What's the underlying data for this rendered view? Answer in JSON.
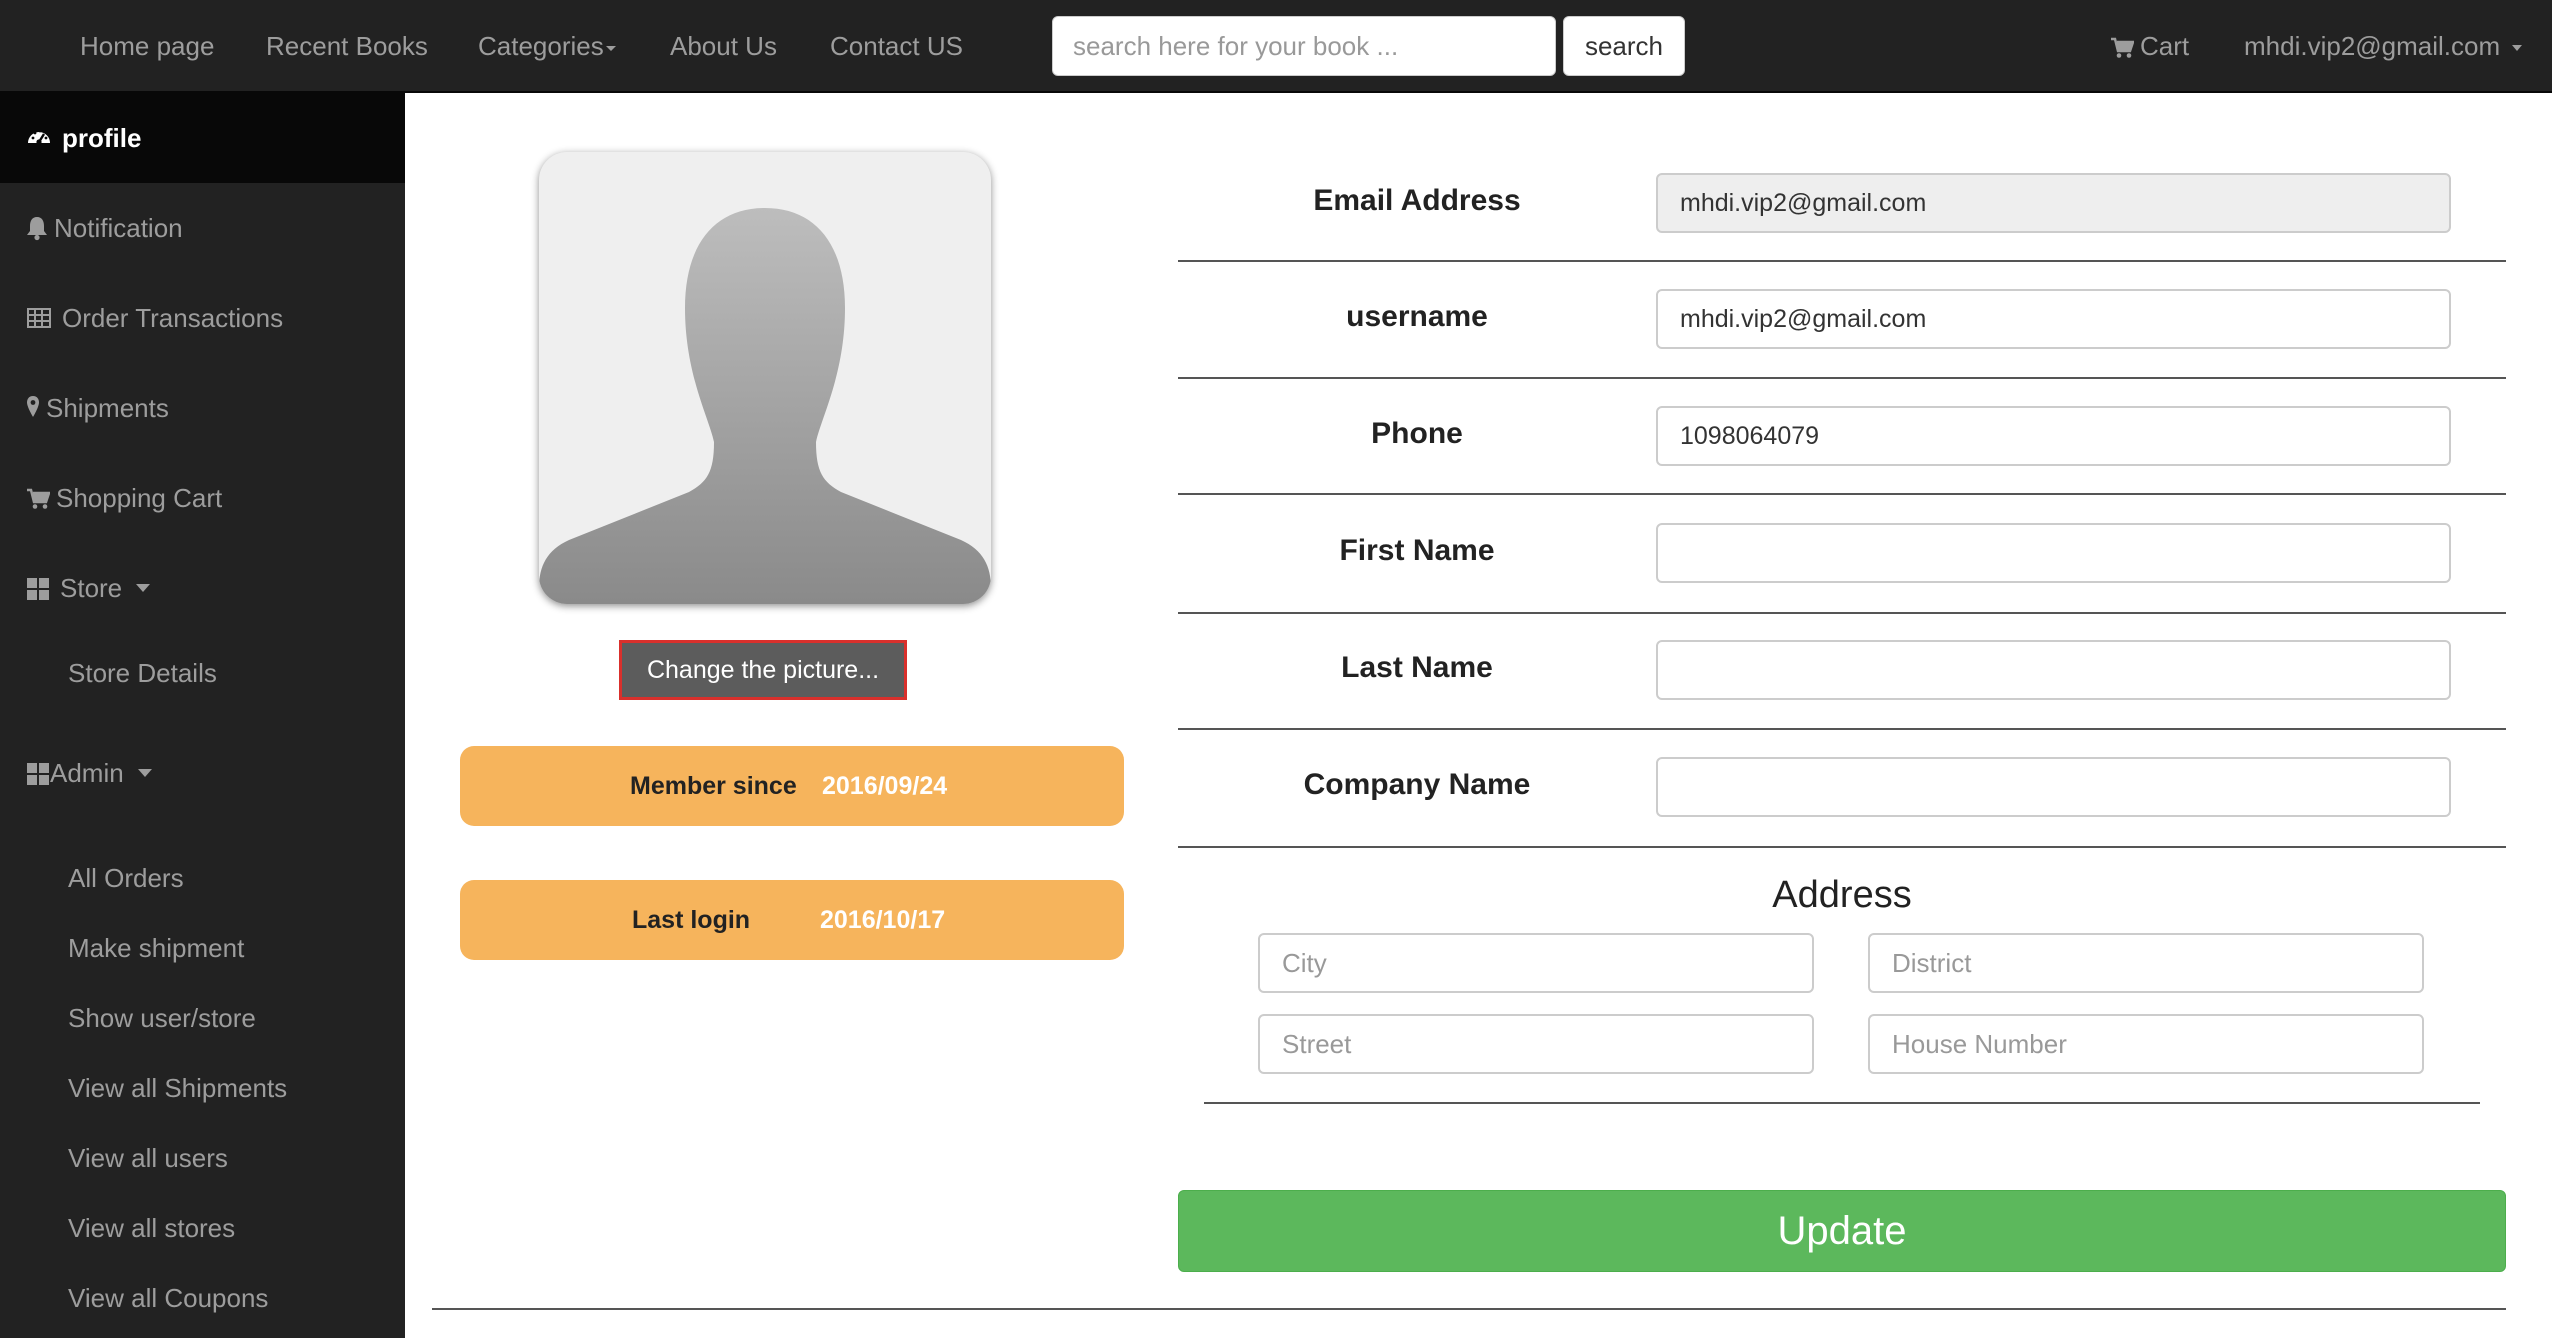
{
  "nav": {
    "home": "Home page",
    "recent": "Recent Books",
    "categories": "Categories",
    "about": "About Us",
    "contact": "Contact US",
    "search_placeholder": "search here for your book ...",
    "search_button": "search",
    "cart": "Cart",
    "user_email": "mhdi.vip2@gmail.com"
  },
  "sidebar": {
    "profile": "profile",
    "notification": "Notification",
    "orders": "Order Transactions",
    "shipments": "Shipments",
    "cart": "Shopping Cart",
    "store": "Store",
    "store_details": "Store Details",
    "admin": "Admin",
    "admin_items": [
      "All Orders",
      "Make shipment",
      "Show user/store",
      "View all Shipments",
      "View all users",
      "View all stores",
      "View all Coupons"
    ]
  },
  "profile": {
    "change_picture": "Change the picture...",
    "member_since_label": "Member since",
    "member_since_value": "2016/09/24",
    "last_login_label": "Last login",
    "last_login_value": "2016/10/17"
  },
  "form": {
    "email_label": "Email Address",
    "email_value": "mhdi.vip2@gmail.com",
    "username_label": "username",
    "username_value": "mhdi.vip2@gmail.com",
    "phone_label": "Phone",
    "phone_value": "1098064079",
    "first_name_label": "First Name",
    "first_name_value": "",
    "last_name_label": "Last Name",
    "last_name_value": "",
    "company_label": "Company Name",
    "company_value": "",
    "address_title": "Address",
    "city_placeholder": "City",
    "district_placeholder": "District",
    "street_placeholder": "Street",
    "house_placeholder": "House Number",
    "update_button": "Update"
  },
  "colors": {
    "navbar": "#222222",
    "pill": "#f6b45c",
    "update": "#5cb85c",
    "change_pic_border": "#d9302c"
  }
}
